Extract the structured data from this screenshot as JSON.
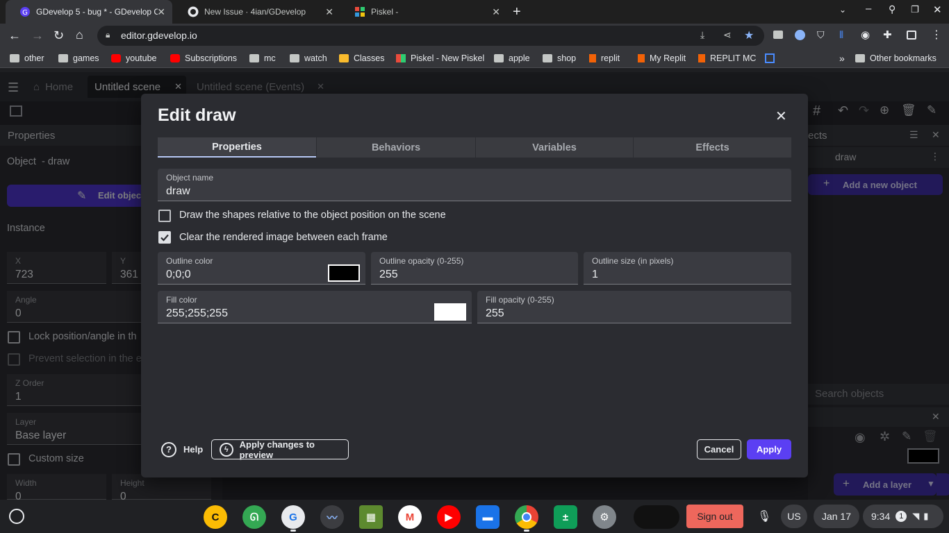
{
  "browser": {
    "tabs": [
      {
        "title": "GDevelop 5 - bug * - GDevelop Cl",
        "active": true
      },
      {
        "title": "New Issue · 4ian/GDevelop",
        "active": false
      },
      {
        "title": "Piskel -",
        "active": false
      }
    ],
    "url": "editor.gdevelop.io",
    "bookmarks": [
      {
        "label": "other",
        "icon": "folder-icon"
      },
      {
        "label": "games",
        "icon": "folder-icon"
      },
      {
        "label": "youtube",
        "icon": "youtube-icon"
      },
      {
        "label": "Subscriptions",
        "icon": "youtube-icon"
      },
      {
        "label": "mc",
        "icon": "folder-icon"
      },
      {
        "label": "watch",
        "icon": "folder-icon"
      },
      {
        "label": "Classes",
        "icon": "classroom-icon"
      },
      {
        "label": "Piskel - New Piskel",
        "icon": "piskel-icon"
      },
      {
        "label": "apple",
        "icon": "folder-icon"
      },
      {
        "label": "shop",
        "icon": "folder-icon"
      },
      {
        "label": "replit",
        "icon": "replit-icon"
      },
      {
        "label": "My Replit",
        "icon": "replit-icon"
      },
      {
        "label": "REPLIT MC",
        "icon": "replit-icon"
      }
    ],
    "other_bookmarks": "Other bookmarks",
    "more_glyph": "»"
  },
  "app": {
    "tabs": {
      "home": "Home",
      "scene": "Untitled scene",
      "events": "Untitled scene (Events)"
    },
    "properties_title": "Properties",
    "object_label": "Object  - draw",
    "edit_object_button": "Edit object",
    "instance_label": "Instance",
    "x_label": "X",
    "x_value": "723",
    "y_label": "Y",
    "y_value": "361",
    "angle_label": "Angle",
    "angle_value": "0",
    "lock_label": "Lock position/angle in th",
    "prevent_label": "Prevent selection in the e",
    "z_label": "Z Order",
    "z_value": "1",
    "layer_label": "Layer",
    "layer_value": "Base layer",
    "custom_size_label": "Custom size",
    "width_label": "Width",
    "width_value": "0",
    "height_label": "Height",
    "height_value": "0",
    "objects_title": "ects",
    "object_item": "draw",
    "add_object_button": "Add a new object",
    "search_placeholder": "Search objects",
    "add_layer_button": "Add a layer"
  },
  "dialog": {
    "title": "Edit draw",
    "tabs": [
      "Properties",
      "Behaviors",
      "Variables",
      "Effects"
    ],
    "object_name_label": "Object name",
    "object_name_value": "draw",
    "checkbox_relative": {
      "label": "Draw the shapes relative to the object position on the scene",
      "checked": false
    },
    "checkbox_clear": {
      "label": "Clear the rendered image between each frame",
      "checked": true
    },
    "outline_color_label": "Outline color",
    "outline_color_value": "0;0;0",
    "outline_swatch": "#000000",
    "outline_opacity_label": "Outline opacity (0-255)",
    "outline_opacity_value": "255",
    "outline_size_label": "Outline size (in pixels)",
    "outline_size_value": "1",
    "fill_color_label": "Fill color",
    "fill_color_value": "255;255;255",
    "fill_swatch": "#ffffff",
    "fill_opacity_label": "Fill opacity (0-255)",
    "fill_opacity_value": "255",
    "help_button": "Help",
    "apply_preview_button": "Apply changes to preview",
    "cancel_button": "Cancel",
    "apply_button": "Apply",
    "accent": "#5b3ff3"
  },
  "taskbar": {
    "sign_out": "Sign out",
    "locale": "US",
    "date": "Jan 17",
    "time": "9:34",
    "notification_count": "1"
  }
}
